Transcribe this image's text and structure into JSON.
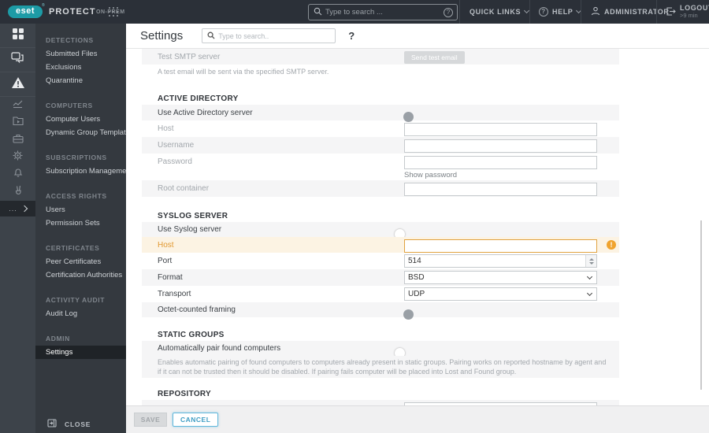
{
  "topbar": {
    "brand": "eset",
    "product": "PROTECT",
    "edition": "ON-PREM",
    "search_placeholder": "Type to search ...",
    "quick_links_label": "QUICK LINKS",
    "help_label": "HELP",
    "user_label": "ADMINISTRATOR",
    "logout_label": "LOGOUT",
    "logout_timer": ">9 min"
  },
  "sidebar": {
    "rail_icons": [
      "dashboard",
      "computers",
      "detections",
      "reports",
      "tasks",
      "installers",
      "policies",
      "notifications",
      "status-overview"
    ],
    "more_label": "...",
    "sections": [
      {
        "title": "DETECTIONS",
        "items": [
          "Submitted Files",
          "Exclusions",
          "Quarantine"
        ]
      },
      {
        "title": "COMPUTERS",
        "items": [
          "Computer Users",
          "Dynamic Group Templates"
        ]
      },
      {
        "title": "SUBSCRIPTIONS",
        "items": [
          "Subscription Management"
        ]
      },
      {
        "title": "ACCESS RIGHTS",
        "items": [
          "Users",
          "Permission Sets"
        ]
      },
      {
        "title": "CERTIFICATES",
        "items": [
          "Peer Certificates",
          "Certification Authorities"
        ]
      },
      {
        "title": "ACTIVITY AUDIT",
        "items": [
          "Audit Log"
        ]
      },
      {
        "title": "ADMIN",
        "items": [
          "Settings"
        ]
      }
    ],
    "selected_item": "Settings",
    "close_label": "CLOSE"
  },
  "page": {
    "title": "Settings",
    "search_placeholder": "Type to search..",
    "help_glyph": "?"
  },
  "content": {
    "smtp": {
      "test_label": "Test SMTP server",
      "test_button_label": "Send test email",
      "test_description": "A test email will be sent via the specified SMTP server."
    },
    "active_directory": {
      "title": "ACTIVE DIRECTORY",
      "use_label": "Use Active Directory server",
      "use_enabled": false,
      "host_label": "Host",
      "host_value": "",
      "username_label": "Username",
      "username_value": "",
      "password_label": "Password",
      "password_value": "",
      "show_password_label": "Show password",
      "root_container_label": "Root container",
      "root_container_value": ""
    },
    "syslog": {
      "title": "SYSLOG SERVER",
      "use_label": "Use Syslog server",
      "use_enabled": true,
      "host_label": "Host",
      "host_value": "",
      "host_warning_glyph": "!",
      "port_label": "Port",
      "port_value": "514",
      "format_label": "Format",
      "format_value": "BSD",
      "transport_label": "Transport",
      "transport_value": "UDP",
      "octet_label": "Octet-counted framing",
      "octet_enabled": false
    },
    "static_groups": {
      "title": "STATIC GROUPS",
      "pair_label": "Automatically pair found computers",
      "pair_enabled": true,
      "pair_description": "Enables automatic pairing of found computers to computers already present in static groups. Pairing works on reported hostname by agent and if it can not be trusted then it should be disabled. If pairing fails computer will be placed into Lost and Found group."
    },
    "repository": {
      "title": "REPOSITORY"
    }
  },
  "footer": {
    "save_label": "SAVE",
    "cancel_label": "CANCEL"
  },
  "colors": {
    "accent_teal": "#1d9ba6",
    "topbar_bg": "#2b3038",
    "rail_bg": "#3d434a",
    "menu_bg": "#34393f",
    "selected_item_bg": "#1f2327",
    "toggle_on": "#59c7f2",
    "warning_orange": "#f0a32e",
    "highlight_row_bg": "#fcf3e3"
  }
}
